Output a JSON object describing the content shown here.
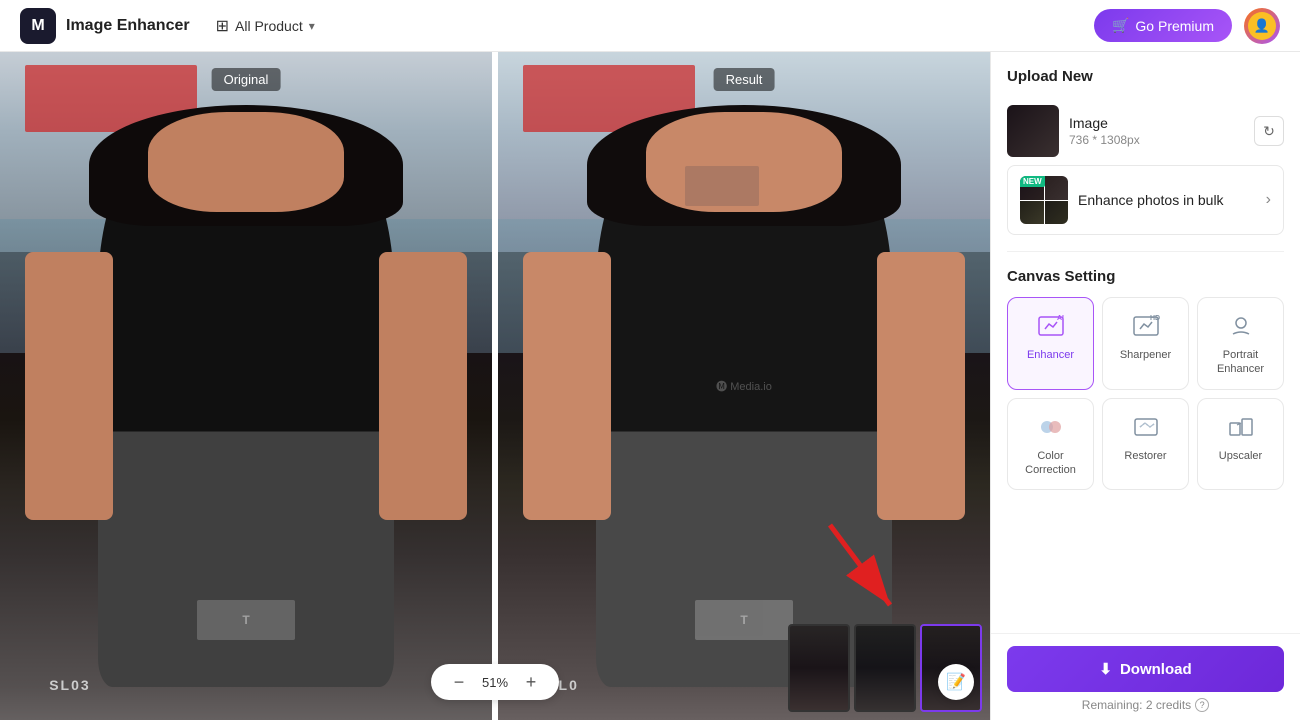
{
  "app": {
    "logo_text": "M",
    "title": "Image Enhancer",
    "all_product_label": "All Product"
  },
  "header": {
    "premium_btn": "Go Premium",
    "all_product_label": "All Product"
  },
  "panels": {
    "original_label": "Original",
    "result_label": "Result"
  },
  "zoom": {
    "value": "51%",
    "decrease_label": "−",
    "increase_label": "+"
  },
  "sidebar": {
    "upload_section_title": "Upload New",
    "image_filename": "Image",
    "image_size": "736 * 1308px",
    "bulk_enhance_label": "Enhance photos in bulk",
    "canvas_section_title": "Canvas Setting",
    "tools": [
      {
        "id": "enhancer",
        "label": "Enhancer",
        "active": true
      },
      {
        "id": "sharpener",
        "label": "Sharpener",
        "active": false
      },
      {
        "id": "portrait-enhancer",
        "label": "Portrait Enhancer",
        "active": false
      },
      {
        "id": "color-correction",
        "label": "Color Correction",
        "active": false
      },
      {
        "id": "restorer",
        "label": "Restorer",
        "active": false
      },
      {
        "id": "upscaler",
        "label": "Upscaler",
        "active": false
      }
    ],
    "download_btn": "Download",
    "credits_text": "Remaining: 2 credits"
  }
}
